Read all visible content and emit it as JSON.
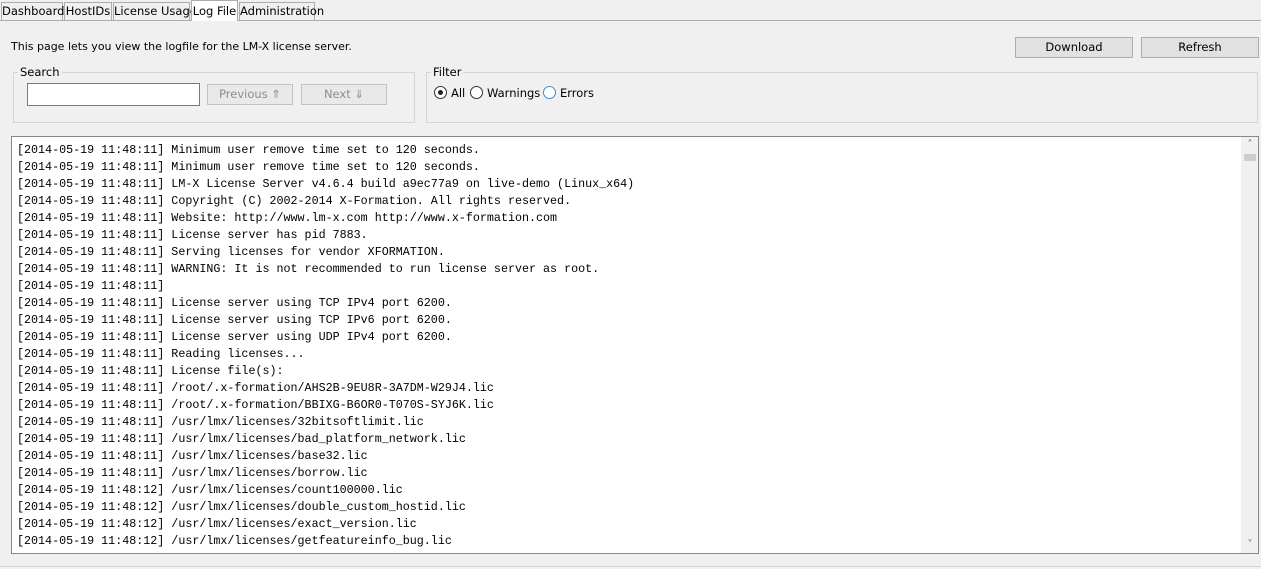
{
  "tabs": [
    {
      "label": "Dashboard",
      "active": false
    },
    {
      "label": "HostIDs",
      "active": false
    },
    {
      "label": "License Usage",
      "active": false
    },
    {
      "label": "Log File",
      "active": true
    },
    {
      "label": "Administration",
      "active": false
    }
  ],
  "intro_text": "This page lets you view the logfile for the LM-X license server.",
  "toolbar": {
    "download_label": "Download",
    "refresh_label": "Refresh"
  },
  "search": {
    "legend": "Search",
    "value": "",
    "previous_label": "Previous ⇑",
    "next_label": "Next ⇓"
  },
  "filter": {
    "legend": "Filter",
    "options": [
      {
        "label": "All",
        "selected": true
      },
      {
        "label": "Warnings",
        "selected": false
      },
      {
        "label": "Errors",
        "selected": false
      }
    ]
  },
  "log_lines": [
    "[2014-05-19 11:48:11] Minimum user remove time set to 120 seconds.",
    "[2014-05-19 11:48:11] Minimum user remove time set to 120 seconds.",
    "[2014-05-19 11:48:11] LM-X License Server v4.6.4 build a9ec77a9 on live-demo (Linux_x64)",
    "[2014-05-19 11:48:11] Copyright (C) 2002-2014 X-Formation. All rights reserved.",
    "[2014-05-19 11:48:11] Website: http://www.lm-x.com http://www.x-formation.com",
    "[2014-05-19 11:48:11] License server has pid 7883.",
    "[2014-05-19 11:48:11] Serving licenses for vendor XFORMATION.",
    "[2014-05-19 11:48:11] WARNING: It is not recommended to run license server as root.",
    "[2014-05-19 11:48:11]",
    "[2014-05-19 11:48:11] License server using TCP IPv4 port 6200.",
    "[2014-05-19 11:48:11] License server using TCP IPv6 port 6200.",
    "[2014-05-19 11:48:11] License server using UDP IPv4 port 6200.",
    "[2014-05-19 11:48:11] Reading licenses...",
    "[2014-05-19 11:48:11] License file(s):",
    "[2014-05-19 11:48:11] /root/.x-formation/AHS2B-9EU8R-3A7DM-W29J4.lic",
    "[2014-05-19 11:48:11] /root/.x-formation/BBIXG-B6OR0-T070S-SYJ6K.lic",
    "[2014-05-19 11:48:11] /usr/lmx/licenses/32bitsoftlimit.lic",
    "[2014-05-19 11:48:11] /usr/lmx/licenses/bad_platform_network.lic",
    "[2014-05-19 11:48:11] /usr/lmx/licenses/base32.lic",
    "[2014-05-19 11:48:11] /usr/lmx/licenses/borrow.lic",
    "[2014-05-19 11:48:12] /usr/lmx/licenses/count100000.lic",
    "[2014-05-19 11:48:12] /usr/lmx/licenses/double_custom_hostid.lic",
    "[2014-05-19 11:48:12] /usr/lmx/licenses/exact_version.lic",
    "[2014-05-19 11:48:12] /usr/lmx/licenses/getfeatureinfo_bug.lic"
  ],
  "scrollbar": {
    "up_icon": "chevron-up-icon",
    "down_icon": "chevron-down-icon"
  }
}
